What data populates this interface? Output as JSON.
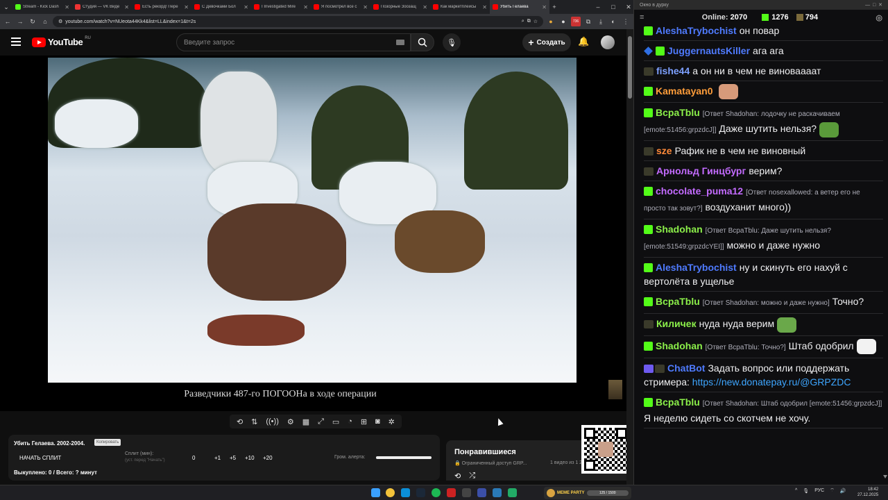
{
  "browser": {
    "tabs": [
      {
        "title": "Stream - Kick Dash",
        "color": "#53fc18"
      },
      {
        "title": "Студия — VK Виде",
        "color": "#e33"
      },
      {
        "title": "Есть рекорд! Пере",
        "color": "#f00"
      },
      {
        "title": "С Девочками Бол",
        "color": "#f00"
      },
      {
        "title": "I Investigated Mire",
        "color": "#f00"
      },
      {
        "title": "Я посмотрел все с",
        "color": "#f00"
      },
      {
        "title": "Позорные Зоозащ",
        "color": "#f00"
      },
      {
        "title": "Как маркетплейсы",
        "color": "#f00"
      },
      {
        "title": "Убить Гелаева",
        "color": "#f00"
      }
    ],
    "url": "youtube.com/watch?v=NUeota44Kk4&list=LL&index=1&t=2s",
    "ext_badge": "736"
  },
  "youtube": {
    "logo_text": "YouTube",
    "country": "RU",
    "search_placeholder": "Введите запрос",
    "create_label": "Создать"
  },
  "video": {
    "caption": "Разведчики 487-го ПОГООНа в ходе операции"
  },
  "split_panel": {
    "title": "Убить Гелаева. 2002-2004.",
    "copy_label": "Копировать",
    "start_label": "НАЧАТЬ СПЛИТ",
    "split_label": "Сплит (мин):",
    "split_sub": "(уст. перед \"Начать\")",
    "values": [
      "0",
      "+1",
      "+5",
      "+10",
      "+20"
    ],
    "alert_label": "Гром. алерта:",
    "alert_volume": 1.0,
    "bought": "Выкуплено: 0 / Всего: ? минут"
  },
  "liked": {
    "title": "Понравившиеся",
    "access": "Ограниченный доступ GRP...",
    "count": "1 видео из 1 226"
  },
  "chat": {
    "window_title": "Окно в дурку",
    "online_label": "Online:",
    "online_count": "2070",
    "kick_count": "1276",
    "bag_count": "794",
    "messages": [
      {
        "user": "AleshaTrybochist",
        "color": "#4f7bff",
        "badge": "kick",
        "text": "он повар"
      },
      {
        "user": "JuggernautsKiller",
        "color": "#4f7bff",
        "badge": "sword",
        "text": "ага ага"
      },
      {
        "user": "fishe44",
        "color": "#7da0ff",
        "badge": "pepe",
        "text": "а он ни в чем не виноваааат"
      },
      {
        "user": "Kamatayan0",
        "color": "#ff9d3a",
        "badge": "kick",
        "text": "",
        "emote": "#d79a7a"
      },
      {
        "user": "BcpaTblu",
        "color": "#8cf04a",
        "badge": "kick",
        "reply": "[Ответ Shadohan: лодочку не раскачиваем [emote:51456:grpzdcJ]]",
        "text": "Даже шутить нельзя?",
        "emote": "#5a9a3a"
      },
      {
        "user": "sze",
        "color": "#ff8a3a",
        "badge": "pepe",
        "text": "Рафик не в чем не виновный"
      },
      {
        "user": "Арнольд Гинцбург",
        "color": "#c36bff",
        "badge": "pepe",
        "text": "верим?"
      },
      {
        "user": "chocolate_puma12",
        "color": "#c36bff",
        "badge": "kick",
        "reply": "[Ответ nosexallowed: а ветер его не просто так зовут?]",
        "text": "воздуханит много))"
      },
      {
        "user": "Shadohan",
        "color": "#8cf04a",
        "badge": "kick",
        "reply": "[Ответ BcpaTblu: Даже шутить нельзя? [emote:51549:grpzdcYEI]]",
        "text": "можно и даже нужно"
      },
      {
        "user": "AleshaTrybochist",
        "color": "#4f7bff",
        "badge": "kick",
        "text": "ну и скинуть его нахуй с вертолёта в ущелье"
      },
      {
        "user": "BcpaTblu",
        "color": "#8cf04a",
        "badge": "kick",
        "reply": "[Ответ Shadohan: можно и даже нужно]",
        "text": "Точно?"
      },
      {
        "user": "Киличек",
        "color": "#8cf04a",
        "badge": "pepe",
        "text": "нуда нуда верим",
        "emote": "#6aa84a"
      },
      {
        "user": "Shadohan",
        "color": "#8cf04a",
        "badge": "kick",
        "reply": "[Ответ BcpaTblu: Точно?]",
        "text": "Штаб одобрил",
        "emote": "#f2f2f2"
      },
      {
        "user": "ChatBot",
        "color": "#4f7bff",
        "badge": "bot",
        "text": "Задать вопрос или поддержать стримера:",
        "link": "https://new.donatepay.ru/@GRPZDC"
      },
      {
        "user": "BcpaTblu",
        "color": "#8cf04a",
        "badge": "kick",
        "reply": "[Ответ Shadohan: Штаб одобрил [emote:51456:grpzdcJ]]",
        "text": "Я неделю сидеть со скотчем не хочу."
      }
    ]
  },
  "taskbar": {
    "meme_label": "MEME PARTY",
    "meme_progress": "125 / 1500",
    "lang": "РУС",
    "time": "18:42",
    "date": "27.12.2025"
  }
}
